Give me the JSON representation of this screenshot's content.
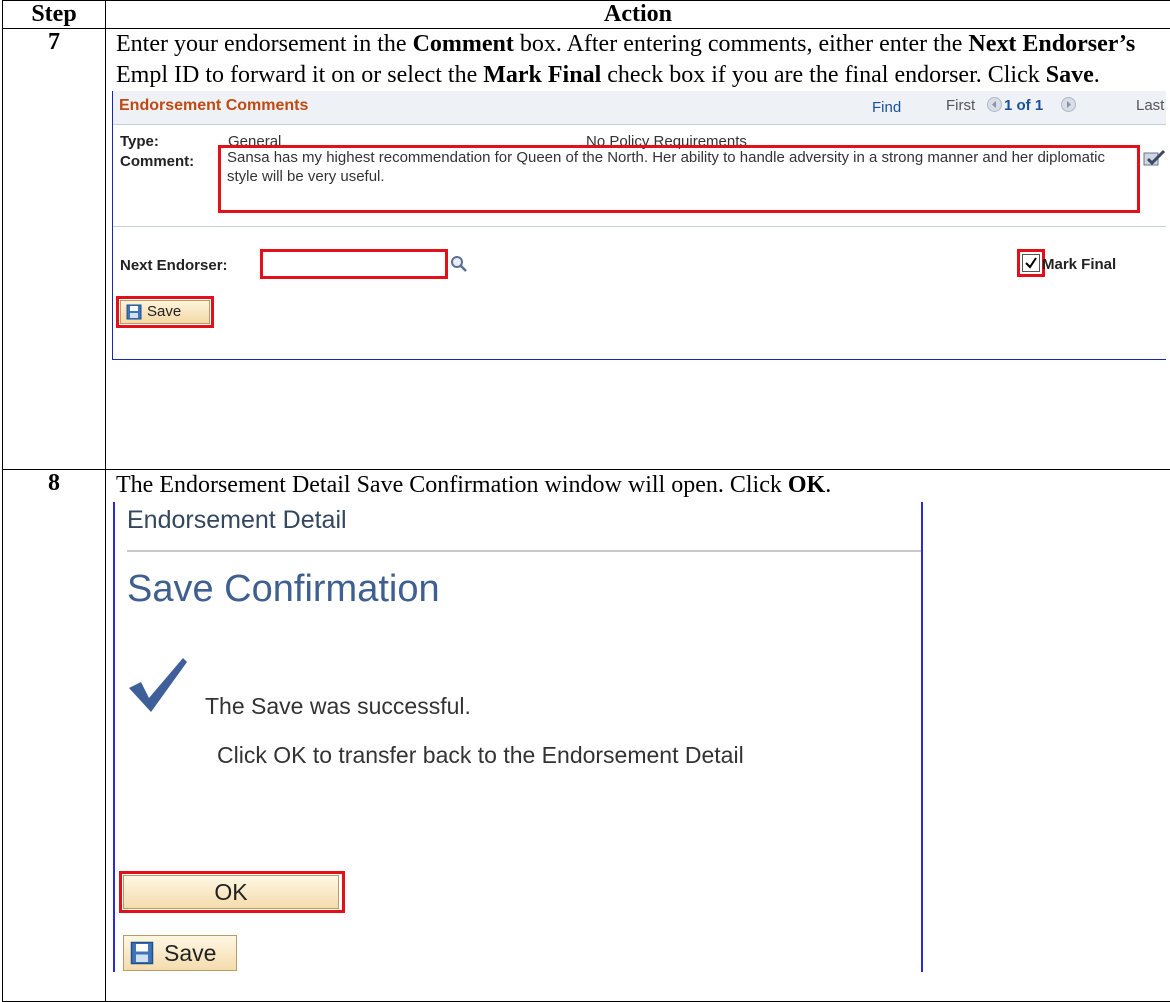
{
  "table": {
    "header_step": "Step",
    "header_action": "Action"
  },
  "step7": {
    "number": "7",
    "text": [
      {
        "t": "Enter your endorsement in the ",
        "b": false
      },
      {
        "t": "Comment",
        "b": true
      },
      {
        "t": " box. After entering comments, either enter the ",
        "b": false
      },
      {
        "t": "Next Endorser’s",
        "b": true
      },
      {
        "t": " Empl ID to forward it on or select the ",
        "b": false
      },
      {
        "t": "Mark Final",
        "b": true
      },
      {
        "t": " check box if you are the final endorser. Click ",
        "b": false
      },
      {
        "t": "Save",
        "b": true
      },
      {
        "t": ".",
        "b": false
      }
    ],
    "panel": {
      "title": "Endorsement Comments",
      "find": "Find",
      "first": "First",
      "count": "1 of 1",
      "last": "Last",
      "type_label": "Type:",
      "type_value": "General",
      "policy": "No Policy Requirements",
      "comment_label": "Comment:",
      "comment_value": "Sansa has my highest recommendation for Queen of the North. Her ability to handle adversity in a strong manner and her diplomatic style will be very useful.",
      "next_endorser_label": "Next Endorser:",
      "next_endorser_value": "",
      "mark_final_label": "Mark Final",
      "mark_final_checked": true,
      "save_label": "Save",
      "icons": [
        "prev-arrow-icon",
        "next-arrow-icon",
        "spellcheck-icon",
        "search-icon",
        "save-disk-icon"
      ],
      "colors": {
        "title": "#c04a12",
        "link": "#1a4fa0",
        "highlight": "#e3101a"
      }
    }
  },
  "step8": {
    "number": "8",
    "text": [
      {
        "t": "The Endorsement Detail Save Confirmation window will open. Click ",
        "b": false
      },
      {
        "t": "OK",
        "b": true
      },
      {
        "t": ".",
        "b": false
      }
    ],
    "panel": {
      "title": "Endorsement Detail",
      "heading": "Save Confirmation",
      "message": "The Save was successful.",
      "message2": "Click OK to transfer back to the Endorsement Detail",
      "ok_label": "OK",
      "save_label": "Save",
      "icons": [
        "checkmark-icon",
        "save-disk-icon"
      ],
      "colors": {
        "heading": "#3e5f8f",
        "frame": "#2a2ae0"
      }
    }
  }
}
